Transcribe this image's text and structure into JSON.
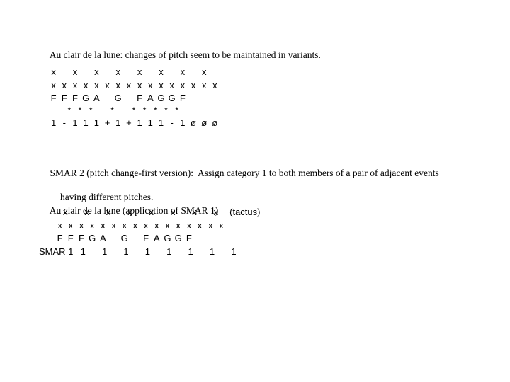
{
  "slide": {
    "intro_line": "Au clair de la lune: changes of pitch seem to be maintained in variants.",
    "smar2_line1": "SMAR 2 (pitch change-first version):  Assign category 1 to both members of a pair of adjacent events",
    "smar2_line2": "having different pitches.",
    "application_heading": "Au clair de la lune (application of SMAR 1)"
  },
  "block_one": {
    "tactus_row": [
      "x",
      "",
      "x",
      "",
      "x",
      "",
      "x",
      "",
      "x",
      "",
      "x",
      "",
      "x",
      "",
      "x",
      ""
    ],
    "pulse_row": [
      "x",
      "x",
      "x",
      "x",
      "x",
      "x",
      "x",
      "x",
      "x",
      "x",
      "x",
      "x",
      "x",
      "x",
      "x",
      "x"
    ],
    "pitch_row": [
      "F",
      "F",
      "F",
      "G",
      "A",
      "",
      "G",
      "",
      "F",
      "A",
      "G",
      "G",
      "F",
      "",
      "",
      ""
    ],
    "star_row": [
      "",
      "*",
      "*",
      "*",
      "",
      "*",
      "",
      "*",
      "*",
      "*",
      "*",
      "*",
      "",
      "",
      "",
      ""
    ],
    "category_row": [
      "1",
      "-",
      "1",
      "1",
      "1",
      "+",
      "1",
      "+",
      "1",
      "1",
      "1",
      "-",
      "1",
      "ø",
      "ø",
      "ø"
    ]
  },
  "block_two": {
    "smar_label": "SMAR 1",
    "tactus_label": "(tactus)",
    "tactus_row": [
      "x",
      "x",
      "x",
      "x",
      "x",
      "x",
      "x",
      "x"
    ],
    "pulse_row": [
      "x",
      "x",
      "x",
      "x",
      "x",
      "x",
      "x",
      "x",
      "x",
      "x",
      "x",
      "x",
      "x",
      "x",
      "x",
      "x"
    ],
    "pitch_row": [
      "F",
      "F",
      "F",
      "G",
      "A",
      "",
      "G",
      "",
      "F",
      "A",
      "G",
      "G",
      "F",
      "",
      "",
      ""
    ],
    "smar_row": [
      "1",
      "1",
      "1",
      "1",
      "1",
      "1",
      "1",
      "1"
    ]
  },
  "colors": {
    "background": "#ffffff",
    "text": "#000000"
  }
}
